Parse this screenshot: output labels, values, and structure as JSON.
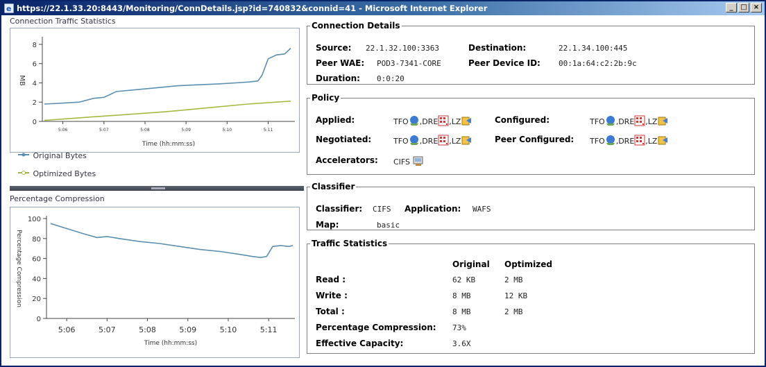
{
  "window": {
    "title": "https://22.1.33.20:8443/Monitoring/ConnDetails.jsp?id=740832&connid=41 - Microsoft Internet Explorer",
    "minimize": "_",
    "maximize": "□",
    "close": "×"
  },
  "traffic_chart": {
    "panel_title": "Connection Traffic Statistics",
    "legend": [
      "Original Bytes",
      "Optimized Bytes"
    ]
  },
  "compression_chart": {
    "panel_title": "Percentage Compression"
  },
  "chart_data": [
    {
      "type": "line",
      "title": "Connection Traffic Statistics",
      "xlabel": "Time (hh:mm:ss)",
      "ylabel": "MB",
      "x_ticks": [
        "5:06",
        "5:07",
        "5:08",
        "5:09",
        "5:10",
        "5:11"
      ],
      "y_ticks": [
        0,
        2,
        4,
        6,
        8
      ],
      "ylim": [
        0,
        8.5
      ],
      "xlim": [
        5.5,
        11.65
      ],
      "grid": false,
      "legend": "bottom-left",
      "series": [
        {
          "name": "Original Bytes",
          "color": "#5a8fb0",
          "x": [
            5.55,
            6.0,
            6.4,
            6.75,
            7.0,
            7.3,
            7.8,
            8.3,
            8.8,
            9.3,
            9.8,
            10.2,
            10.55,
            10.75,
            10.85,
            11.0,
            11.2,
            11.4,
            11.55
          ],
          "y": [
            1.8,
            1.9,
            2.0,
            2.4,
            2.5,
            3.1,
            3.3,
            3.5,
            3.7,
            3.8,
            3.9,
            4.0,
            4.1,
            4.2,
            4.8,
            6.5,
            6.9,
            7.0,
            7.6
          ]
        },
        {
          "name": "Optimized Bytes",
          "color": "#a7b842",
          "x": [
            5.55,
            6.5,
            7.5,
            8.5,
            9.5,
            10.5,
            11.55
          ],
          "y": [
            0.1,
            0.4,
            0.7,
            1.0,
            1.4,
            1.8,
            2.1
          ]
        }
      ]
    },
    {
      "type": "line",
      "title": "Percentage Compression",
      "xlabel": "Time (hh:mm:ss)",
      "ylabel": "Percentage Compression",
      "x_ticks": [
        "5:06",
        "5:07",
        "5:08",
        "5:09",
        "5:10",
        "5:11"
      ],
      "y_ticks": [
        0,
        20,
        40,
        60,
        80,
        100
      ],
      "ylim": [
        0,
        100
      ],
      "xlim": [
        5.5,
        11.65
      ],
      "grid": false,
      "series": [
        {
          "name": "Percentage Compression",
          "color": "#5a8fb0",
          "x": [
            5.6,
            6.0,
            6.4,
            6.75,
            7.0,
            7.3,
            7.8,
            8.3,
            8.8,
            9.3,
            9.8,
            10.3,
            10.6,
            10.8,
            10.95,
            11.1,
            11.3,
            11.5,
            11.6
          ],
          "y": [
            95,
            90,
            85,
            81,
            82,
            80,
            77,
            75,
            72,
            69,
            67,
            64,
            62,
            61,
            62,
            72,
            73,
            72,
            73
          ]
        }
      ]
    }
  ],
  "connection_details": {
    "legend": "Connection Details",
    "source_label": "Source:",
    "source_value": "22.1.32.100:3363",
    "destination_label": "Destination:",
    "destination_value": "22.1.34.100:445",
    "peer_wae_label": "Peer WAE:",
    "peer_wae_value": "POD3-7341-CORE",
    "peer_device_id_label": "Peer Device ID:",
    "peer_device_id_value": "00:1a:64:c2:2b:9c",
    "duration_label": "Duration:",
    "duration_value": "0:0:20"
  },
  "policy": {
    "legend": "Policy",
    "applied_label": "Applied:",
    "configured_label": "Configured:",
    "negotiated_label": "Negotiated:",
    "peer_configured_label": "Peer Configured:",
    "accelerators_label": "Accelerators:",
    "accelerators_value": "CIFS",
    "tfo": "TFO",
    "dre": ",DRE",
    "lz": ",LZ"
  },
  "classifier": {
    "legend": "Classifier",
    "classifier_label": "Classifier:",
    "classifier_value": "CIFS",
    "application_label": "Application:",
    "application_value": "WAFS",
    "map_label": "Map:",
    "map_value": "basic"
  },
  "traffic_statistics": {
    "legend": "Traffic Statistics",
    "col_original": "Original",
    "col_optimized": "Optimized",
    "rows": [
      {
        "label": "Read :",
        "original": "62 KB",
        "optimized": "2 MB"
      },
      {
        "label": "Write :",
        "original": "8 MB",
        "optimized": "12 KB"
      },
      {
        "label": "Total :",
        "original": "8 MB",
        "optimized": "2 MB"
      }
    ],
    "pct_label": "Percentage Compression:",
    "pct_value": "73%",
    "capacity_label": "Effective Capacity:",
    "capacity_value": "3.6X"
  }
}
